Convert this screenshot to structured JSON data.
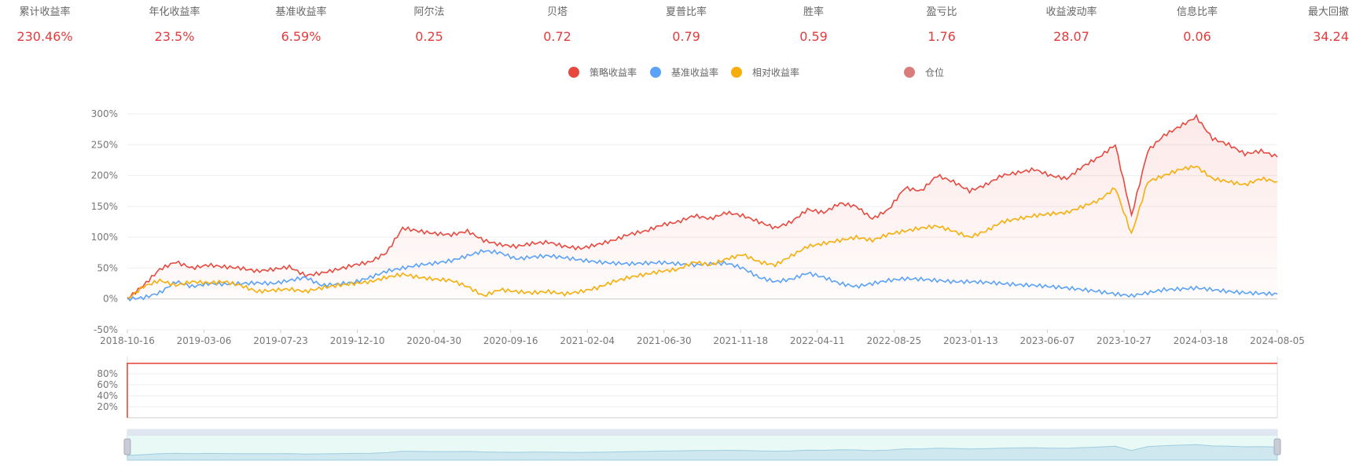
{
  "stats": [
    {
      "label": "累计收益率",
      "value": "230.46%"
    },
    {
      "label": "年化收益率",
      "value": "23.5%"
    },
    {
      "label": "基准收益率",
      "value": "6.59%"
    },
    {
      "label": "阿尔法",
      "value": "0.25"
    },
    {
      "label": "贝塔",
      "value": "0.72"
    },
    {
      "label": "夏普比率",
      "value": "0.79"
    },
    {
      "label": "胜率",
      "value": "0.59"
    },
    {
      "label": "盈亏比",
      "value": "1.76"
    },
    {
      "label": "收益波动率",
      "value": "28.07"
    },
    {
      "label": "信息比率",
      "value": "0.06"
    },
    {
      "label": "最大回撤",
      "value": "34.24"
    }
  ],
  "colors": {
    "strategy": "#e8493f",
    "benchmark": "#5aa2f7",
    "relative": "#f6ae0a",
    "position": "#d97c7c",
    "value_text": "#e43b3b",
    "grid": "#eeeeee"
  },
  "chart_data": [
    {
      "type": "line",
      "legend": [
        "策略收益率",
        "基准收益率",
        "相对收益率",
        "仓位"
      ],
      "x_ticks": [
        "2018-10-16",
        "2019-03-06",
        "2019-07-23",
        "2019-12-10",
        "2020-04-30",
        "2020-09-16",
        "2021-02-04",
        "2021-06-30",
        "2021-11-18",
        "2022-04-11",
        "2022-08-25",
        "2023-01-13",
        "2023-06-07",
        "2023-10-27",
        "2024-03-18",
        "2024-08-05"
      ],
      "y_ticks": [
        "-50%",
        "0%",
        "50%",
        "100%",
        "150%",
        "200%",
        "250%",
        "300%"
      ],
      "ylim": [
        -50,
        300
      ],
      "grid": true,
      "series": [
        {
          "name": "策略收益率",
          "values": [
            0,
            22,
            48,
            60,
            50,
            55,
            52,
            50,
            45,
            48,
            52,
            38,
            42,
            48,
            55,
            60,
            75,
            115,
            110,
            106,
            104,
            110,
            95,
            88,
            85,
            90,
            92,
            85,
            82,
            88,
            95,
            105,
            110,
            120,
            125,
            135,
            130,
            140,
            135,
            125,
            115,
            125,
            145,
            140,
            155,
            150,
            130,
            145,
            180,
            175,
            200,
            190,
            175,
            185,
            200,
            205,
            210,
            200,
            195,
            215,
            230,
            250,
            135,
            240,
            265,
            280,
            295,
            260,
            250,
            235,
            240,
            230
          ]
        },
        {
          "name": "基准收益率",
          "values": [
            0,
            2,
            10,
            28,
            20,
            25,
            24,
            25,
            26,
            25,
            30,
            35,
            22,
            24,
            27,
            35,
            45,
            50,
            55,
            58,
            62,
            70,
            78,
            75,
            65,
            68,
            70,
            67,
            63,
            60,
            58,
            57,
            58,
            59,
            57,
            55,
            57,
            58,
            50,
            35,
            28,
            32,
            42,
            35,
            25,
            20,
            25,
            30,
            33,
            32,
            30,
            28,
            28,
            27,
            25,
            23,
            22,
            20,
            18,
            15,
            12,
            8,
            5,
            10,
            15,
            16,
            18,
            15,
            12,
            10,
            9,
            8
          ]
        },
        {
          "name": "相对收益率",
          "values": [
            0,
            20,
            30,
            22,
            28,
            26,
            28,
            22,
            12,
            14,
            16,
            12,
            18,
            22,
            25,
            28,
            35,
            40,
            35,
            32,
            30,
            20,
            5,
            15,
            12,
            10,
            12,
            8,
            12,
            18,
            28,
            35,
            40,
            45,
            48,
            60,
            55,
            65,
            72,
            60,
            55,
            70,
            85,
            90,
            95,
            100,
            95,
            105,
            110,
            115,
            118,
            110,
            100,
            110,
            125,
            130,
            135,
            138,
            140,
            150,
            160,
            180,
            105,
            190,
            200,
            210,
            215,
            195,
            190,
            185,
            195,
            190
          ]
        }
      ]
    },
    {
      "type": "line",
      "y_ticks": [
        "20%",
        "40%",
        "60%",
        "80%"
      ],
      "ylim": [
        0,
        100
      ],
      "series": [
        {
          "name": "仓位",
          "values": [
            0,
            99,
            99,
            99,
            99,
            99,
            99,
            99,
            99,
            99,
            99,
            99,
            99,
            99,
            99,
            99,
            99,
            99,
            99,
            99,
            99,
            99,
            99,
            99,
            99,
            99,
            99,
            99,
            99,
            99,
            99,
            99,
            99,
            99,
            99,
            99,
            99,
            99,
            99,
            99,
            99,
            99,
            99,
            99,
            99,
            99,
            99,
            99,
            99,
            99,
            99,
            99,
            99,
            99,
            99,
            99,
            99,
            99,
            99,
            99,
            99,
            99,
            99,
            99,
            99,
            99,
            99,
            99,
            99,
            99,
            99,
            99
          ]
        }
      ]
    }
  ]
}
